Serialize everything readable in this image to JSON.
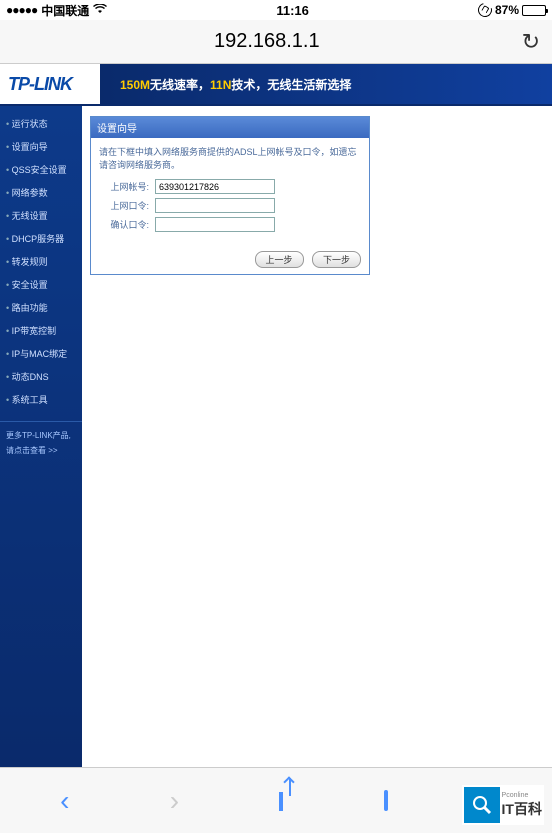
{
  "status": {
    "signal": "●●●●●",
    "carrier": "中国联通",
    "time": "11:16",
    "battery_pct": "87%"
  },
  "browser": {
    "url": "192.168.1.1"
  },
  "router": {
    "logo": "TP-LINK",
    "slogan_hl1": "150M",
    "slogan_t1": "无线速率，",
    "slogan_hl2": "11N",
    "slogan_t2": "技术，无线生活新选择",
    "nav": [
      "运行状态",
      "设置向导",
      "QSS安全设置",
      "网络参数",
      "无线设置",
      "DHCP服务器",
      "转发规则",
      "安全设置",
      "路由功能",
      "IP带宽控制",
      "IP与MAC绑定",
      "动态DNS",
      "系统工具"
    ],
    "nav_more1": "更多TP-LINK产品,",
    "nav_more2": "请点击查看 >>",
    "panel": {
      "title": "设置向导",
      "instruction": "请在下框中填入网络服务商提供的ADSL上网帐号及口令，如遗忘请咨询网络服务商。",
      "labels": {
        "acct": "上网帐号:",
        "pwd": "上网口令:",
        "cpwd": "确认口令:"
      },
      "values": {
        "acct": "639301217826",
        "pwd": "",
        "cpwd": ""
      },
      "btn_prev": "上一步",
      "btn_next": "下一步"
    }
  },
  "watermark": {
    "brand": "IT百科",
    "sub": "Pconline"
  }
}
